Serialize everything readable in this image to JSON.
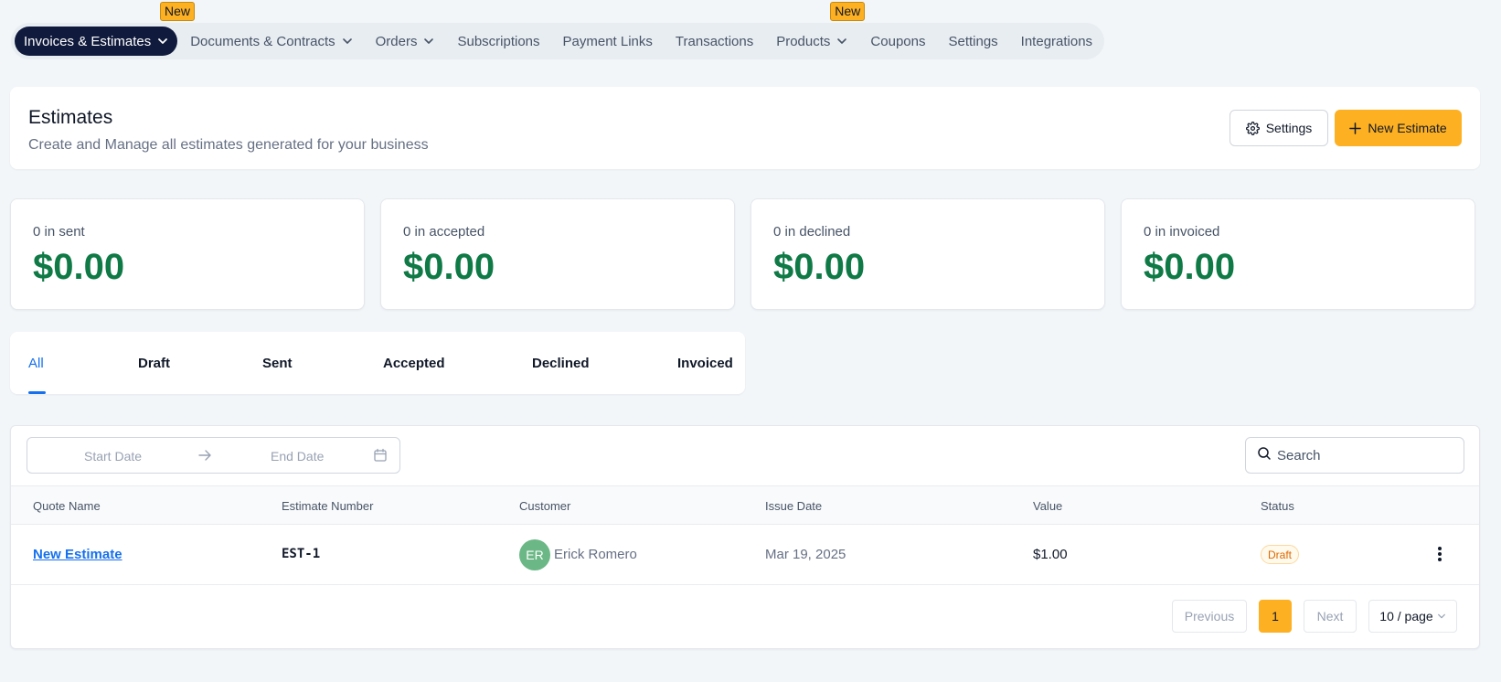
{
  "nav": {
    "items": [
      {
        "label": "Invoices & Estimates",
        "active": true,
        "dropdown": true,
        "badge": "New"
      },
      {
        "label": "Documents & Contracts",
        "active": false,
        "dropdown": true,
        "badge": ""
      },
      {
        "label": "Orders",
        "active": false,
        "dropdown": true,
        "badge": ""
      },
      {
        "label": "Subscriptions",
        "active": false,
        "dropdown": false,
        "badge": ""
      },
      {
        "label": "Payment Links",
        "active": false,
        "dropdown": false,
        "badge": ""
      },
      {
        "label": "Transactions",
        "active": false,
        "dropdown": false,
        "badge": ""
      },
      {
        "label": "Products",
        "active": false,
        "dropdown": true,
        "badge": "New"
      },
      {
        "label": "Coupons",
        "active": false,
        "dropdown": false,
        "badge": ""
      },
      {
        "label": "Settings",
        "active": false,
        "dropdown": false,
        "badge": ""
      },
      {
        "label": "Integrations",
        "active": false,
        "dropdown": false,
        "badge": ""
      }
    ]
  },
  "header": {
    "title": "Estimates",
    "subtitle": "Create and Manage all estimates generated for your business",
    "settings_label": "Settings",
    "new_estimate_label": "New Estimate"
  },
  "stats": [
    {
      "label": "0 in sent",
      "value": "$0.00"
    },
    {
      "label": "0 in accepted",
      "value": "$0.00"
    },
    {
      "label": "0 in declined",
      "value": "$0.00"
    },
    {
      "label": "0 in invoiced",
      "value": "$0.00"
    }
  ],
  "tabs": [
    {
      "label": "All",
      "active": true
    },
    {
      "label": "Draft",
      "active": false
    },
    {
      "label": "Sent",
      "active": false
    },
    {
      "label": "Accepted",
      "active": false
    },
    {
      "label": "Declined",
      "active": false
    },
    {
      "label": "Invoiced",
      "active": false
    }
  ],
  "filters": {
    "start_placeholder": "Start Date",
    "end_placeholder": "End Date",
    "search_placeholder": "Search"
  },
  "table": {
    "columns": [
      "Quote Name",
      "Estimate Number",
      "Customer",
      "Issue Date",
      "Value",
      "Status"
    ],
    "rows": [
      {
        "quote_name": "New Estimate",
        "estimate_number": "EST-1",
        "customer_initials": "ER",
        "customer_name": "Erick Romero",
        "issue_date": "Mar 19, 2025",
        "value": "$1.00",
        "status": "Draft"
      }
    ]
  },
  "pagination": {
    "previous_label": "Previous",
    "current_page": "1",
    "next_label": "Next",
    "page_size_label": "10 / page"
  },
  "colors": {
    "accent": "#fdb022",
    "nav_active": "#101a3c",
    "stat_value": "#0f7a46",
    "link": "#1570ef",
    "avatar": "#6bb886",
    "draft_badge": "#dc6803"
  }
}
